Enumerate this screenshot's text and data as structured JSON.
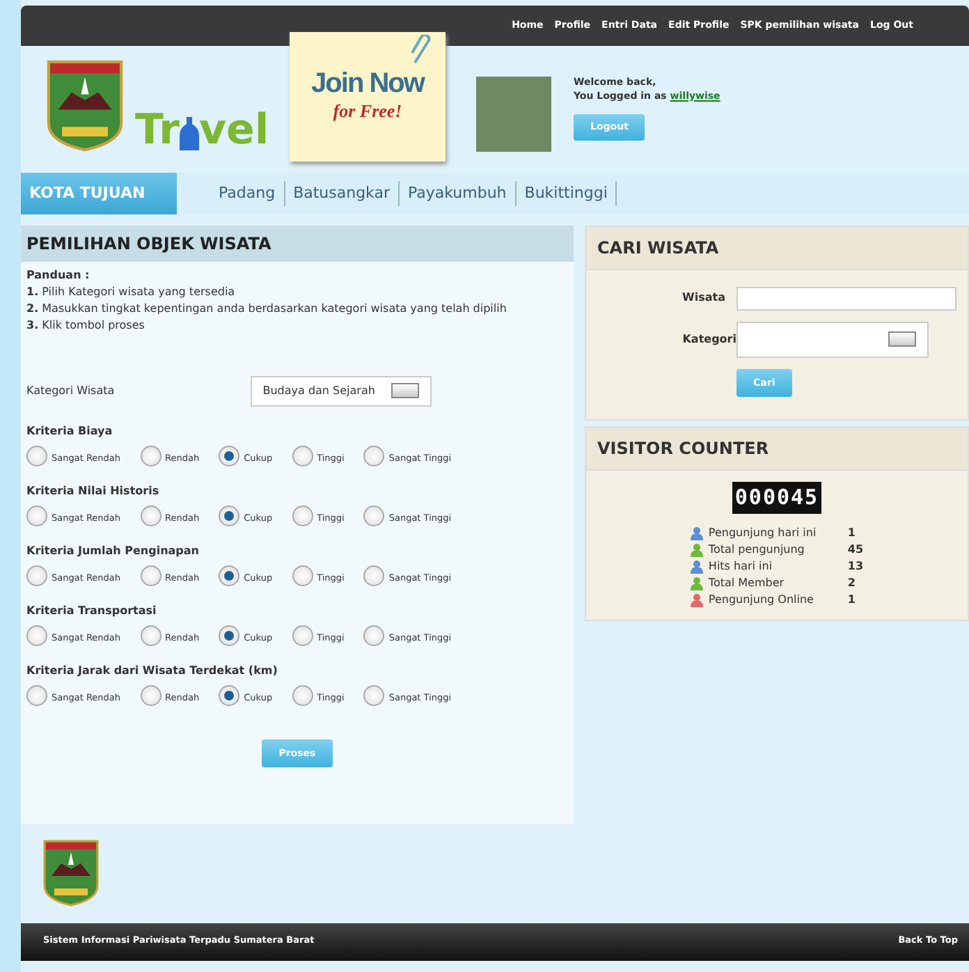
{
  "top_nav": [
    {
      "label": "Home"
    },
    {
      "label": "Profile"
    },
    {
      "label": "Entri Data"
    },
    {
      "label": "Edit Profile"
    },
    {
      "label": "SPK pemilihan wisata"
    },
    {
      "label": "Log Out"
    }
  ],
  "logo": {
    "text_before": "Tr",
    "text_after": "vel"
  },
  "join_note": {
    "title": "Join Now",
    "subtitle": "for Free!"
  },
  "user": {
    "greeting": "Welcome back,",
    "logged_in_as": "You Logged in as",
    "username": "willywise",
    "logout": "Logout"
  },
  "city_tabs": {
    "heading": "KOTA TUJUAN",
    "items": [
      {
        "label": "Padang"
      },
      {
        "label": "Batusangkar"
      },
      {
        "label": "Payakumbuh"
      },
      {
        "label": "Bukittinggi"
      }
    ]
  },
  "main_panel": {
    "title": "PEMILIHAN OBJEK WISATA",
    "guide_title": "Panduan :",
    "guide_steps": [
      {
        "number": "1.",
        "text": "Pilih Kategori wisata yang tersedia"
      },
      {
        "number": "2.",
        "text": "Masukkan tingkat kepentingan anda berdasarkan kategori wisata yang telah dipilih"
      },
      {
        "number": "3.",
        "text": "Klik tombol proses"
      }
    ],
    "category_label": "Kategori Wisata",
    "category_value": "Budaya dan Sejarah",
    "criteria": [
      {
        "title": "Kriteria Biaya",
        "options": [
          {
            "label": "Sangat Rendah",
            "selected": false
          },
          {
            "label": "Rendah",
            "selected": false
          },
          {
            "label": "Cukup",
            "selected": true
          },
          {
            "label": "Tinggi",
            "selected": false
          },
          {
            "label": "Sangat Tinggi",
            "selected": false
          }
        ]
      },
      {
        "title": "Kriteria Nilai Historis",
        "options": [
          {
            "label": "Sangat Rendah",
            "selected": false
          },
          {
            "label": "Rendah",
            "selected": false
          },
          {
            "label": "Cukup",
            "selected": true
          },
          {
            "label": "Tinggi",
            "selected": false
          },
          {
            "label": "Sangat Tinggi",
            "selected": false
          }
        ]
      },
      {
        "title": "Kriteria Jumlah Penginapan",
        "options": [
          {
            "label": "Sangat Rendah",
            "selected": false
          },
          {
            "label": "Rendah",
            "selected": false
          },
          {
            "label": "Cukup",
            "selected": true
          },
          {
            "label": "Tinggi",
            "selected": false
          },
          {
            "label": "Sangat Tinggi",
            "selected": false
          }
        ]
      },
      {
        "title": "Kriteria Transportasi",
        "options": [
          {
            "label": "Sangat Rendah",
            "selected": false
          },
          {
            "label": "Rendah",
            "selected": false
          },
          {
            "label": "Cukup",
            "selected": true
          },
          {
            "label": "Tinggi",
            "selected": false
          },
          {
            "label": "Sangat Tinggi",
            "selected": false
          }
        ]
      },
      {
        "title": "Kriteria Jarak dari Wisata Terdekat (km)",
        "options": [
          {
            "label": "Sangat Rendah",
            "selected": false
          },
          {
            "label": "Rendah",
            "selected": false
          },
          {
            "label": "Cukup",
            "selected": true
          },
          {
            "label": "Tinggi",
            "selected": false
          },
          {
            "label": "Sangat Tinggi",
            "selected": false
          }
        ]
      }
    ],
    "submit": "Proses"
  },
  "search_panel": {
    "title": "CARI WISATA",
    "wisata_label": "Wisata",
    "kategori_label": "Kategori",
    "button": "Cari"
  },
  "counter_panel": {
    "title": "VISITOR COUNTER",
    "digits": "000045",
    "stats": [
      {
        "label": "Pengunjung hari ini",
        "value": "1",
        "color": "#5b8fd6"
      },
      {
        "label": "Total pengunjung",
        "value": "45",
        "color": "#6fb83c"
      },
      {
        "label": "Hits hari ini",
        "value": "13",
        "color": "#5b8fd6"
      },
      {
        "label": "Total Member",
        "value": "2",
        "color": "#6fb83c"
      },
      {
        "label": "Pengunjung Online",
        "value": "1",
        "color": "#e06a6a"
      }
    ]
  },
  "footer": {
    "text": "Sistem Informasi Pariwisata Terpadu Sumatera Barat",
    "back_to_top": "Back To Top"
  }
}
